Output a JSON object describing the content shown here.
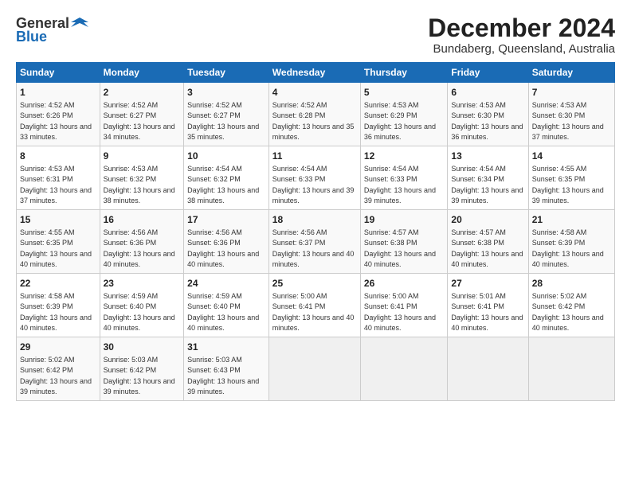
{
  "header": {
    "logo_line1": "General",
    "logo_line2": "Blue",
    "title": "December 2024",
    "subtitle": "Bundaberg, Queensland, Australia"
  },
  "columns": [
    "Sunday",
    "Monday",
    "Tuesday",
    "Wednesday",
    "Thursday",
    "Friday",
    "Saturday"
  ],
  "weeks": [
    [
      {
        "day": "1",
        "sunrise": "Sunrise: 4:52 AM",
        "sunset": "Sunset: 6:26 PM",
        "daylight": "Daylight: 13 hours and 33 minutes."
      },
      {
        "day": "2",
        "sunrise": "Sunrise: 4:52 AM",
        "sunset": "Sunset: 6:27 PM",
        "daylight": "Daylight: 13 hours and 34 minutes."
      },
      {
        "day": "3",
        "sunrise": "Sunrise: 4:52 AM",
        "sunset": "Sunset: 6:27 PM",
        "daylight": "Daylight: 13 hours and 35 minutes."
      },
      {
        "day": "4",
        "sunrise": "Sunrise: 4:52 AM",
        "sunset": "Sunset: 6:28 PM",
        "daylight": "Daylight: 13 hours and 35 minutes."
      },
      {
        "day": "5",
        "sunrise": "Sunrise: 4:53 AM",
        "sunset": "Sunset: 6:29 PM",
        "daylight": "Daylight: 13 hours and 36 minutes."
      },
      {
        "day": "6",
        "sunrise": "Sunrise: 4:53 AM",
        "sunset": "Sunset: 6:30 PM",
        "daylight": "Daylight: 13 hours and 36 minutes."
      },
      {
        "day": "7",
        "sunrise": "Sunrise: 4:53 AM",
        "sunset": "Sunset: 6:30 PM",
        "daylight": "Daylight: 13 hours and 37 minutes."
      }
    ],
    [
      {
        "day": "8",
        "sunrise": "Sunrise: 4:53 AM",
        "sunset": "Sunset: 6:31 PM",
        "daylight": "Daylight: 13 hours and 37 minutes."
      },
      {
        "day": "9",
        "sunrise": "Sunrise: 4:53 AM",
        "sunset": "Sunset: 6:32 PM",
        "daylight": "Daylight: 13 hours and 38 minutes."
      },
      {
        "day": "10",
        "sunrise": "Sunrise: 4:54 AM",
        "sunset": "Sunset: 6:32 PM",
        "daylight": "Daylight: 13 hours and 38 minutes."
      },
      {
        "day": "11",
        "sunrise": "Sunrise: 4:54 AM",
        "sunset": "Sunset: 6:33 PM",
        "daylight": "Daylight: 13 hours and 39 minutes."
      },
      {
        "day": "12",
        "sunrise": "Sunrise: 4:54 AM",
        "sunset": "Sunset: 6:33 PM",
        "daylight": "Daylight: 13 hours and 39 minutes."
      },
      {
        "day": "13",
        "sunrise": "Sunrise: 4:54 AM",
        "sunset": "Sunset: 6:34 PM",
        "daylight": "Daylight: 13 hours and 39 minutes."
      },
      {
        "day": "14",
        "sunrise": "Sunrise: 4:55 AM",
        "sunset": "Sunset: 6:35 PM",
        "daylight": "Daylight: 13 hours and 39 minutes."
      }
    ],
    [
      {
        "day": "15",
        "sunrise": "Sunrise: 4:55 AM",
        "sunset": "Sunset: 6:35 PM",
        "daylight": "Daylight: 13 hours and 40 minutes."
      },
      {
        "day": "16",
        "sunrise": "Sunrise: 4:56 AM",
        "sunset": "Sunset: 6:36 PM",
        "daylight": "Daylight: 13 hours and 40 minutes."
      },
      {
        "day": "17",
        "sunrise": "Sunrise: 4:56 AM",
        "sunset": "Sunset: 6:36 PM",
        "daylight": "Daylight: 13 hours and 40 minutes."
      },
      {
        "day": "18",
        "sunrise": "Sunrise: 4:56 AM",
        "sunset": "Sunset: 6:37 PM",
        "daylight": "Daylight: 13 hours and 40 minutes."
      },
      {
        "day": "19",
        "sunrise": "Sunrise: 4:57 AM",
        "sunset": "Sunset: 6:38 PM",
        "daylight": "Daylight: 13 hours and 40 minutes."
      },
      {
        "day": "20",
        "sunrise": "Sunrise: 4:57 AM",
        "sunset": "Sunset: 6:38 PM",
        "daylight": "Daylight: 13 hours and 40 minutes."
      },
      {
        "day": "21",
        "sunrise": "Sunrise: 4:58 AM",
        "sunset": "Sunset: 6:39 PM",
        "daylight": "Daylight: 13 hours and 40 minutes."
      }
    ],
    [
      {
        "day": "22",
        "sunrise": "Sunrise: 4:58 AM",
        "sunset": "Sunset: 6:39 PM",
        "daylight": "Daylight: 13 hours and 40 minutes."
      },
      {
        "day": "23",
        "sunrise": "Sunrise: 4:59 AM",
        "sunset": "Sunset: 6:40 PM",
        "daylight": "Daylight: 13 hours and 40 minutes."
      },
      {
        "day": "24",
        "sunrise": "Sunrise: 4:59 AM",
        "sunset": "Sunset: 6:40 PM",
        "daylight": "Daylight: 13 hours and 40 minutes."
      },
      {
        "day": "25",
        "sunrise": "Sunrise: 5:00 AM",
        "sunset": "Sunset: 6:41 PM",
        "daylight": "Daylight: 13 hours and 40 minutes."
      },
      {
        "day": "26",
        "sunrise": "Sunrise: 5:00 AM",
        "sunset": "Sunset: 6:41 PM",
        "daylight": "Daylight: 13 hours and 40 minutes."
      },
      {
        "day": "27",
        "sunrise": "Sunrise: 5:01 AM",
        "sunset": "Sunset: 6:41 PM",
        "daylight": "Daylight: 13 hours and 40 minutes."
      },
      {
        "day": "28",
        "sunrise": "Sunrise: 5:02 AM",
        "sunset": "Sunset: 6:42 PM",
        "daylight": "Daylight: 13 hours and 40 minutes."
      }
    ],
    [
      {
        "day": "29",
        "sunrise": "Sunrise: 5:02 AM",
        "sunset": "Sunset: 6:42 PM",
        "daylight": "Daylight: 13 hours and 39 minutes."
      },
      {
        "day": "30",
        "sunrise": "Sunrise: 5:03 AM",
        "sunset": "Sunset: 6:42 PM",
        "daylight": "Daylight: 13 hours and 39 minutes."
      },
      {
        "day": "31",
        "sunrise": "Sunrise: 5:03 AM",
        "sunset": "Sunset: 6:43 PM",
        "daylight": "Daylight: 13 hours and 39 minutes."
      },
      null,
      null,
      null,
      null
    ]
  ]
}
